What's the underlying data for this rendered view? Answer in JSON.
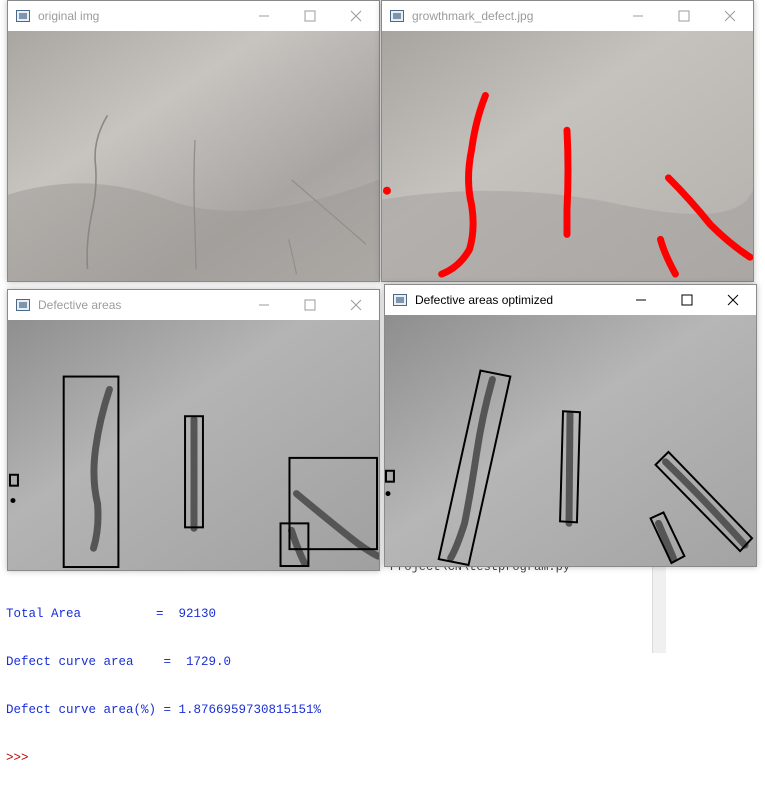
{
  "shell": {
    "total_area_line": "Total Area          =  92130",
    "defect_curve_line": "Defect curve area    =  1729.0",
    "defect_percent_line": "Defect curve area(%) = 1.8766959730815151%",
    "prompt": ">>>"
  },
  "windows": {
    "original": {
      "title": "original img"
    },
    "growthmark": {
      "title": "growthmark_defect.jpg"
    },
    "defective": {
      "title": "Defective areas"
    },
    "optimized": {
      "title": "Defective areas optimized"
    }
  },
  "icons": {
    "minimize": "minimize-icon",
    "maximize": "maximize-icon",
    "close": "close-icon",
    "app": "opencv-window-icon"
  },
  "colors": {
    "defect_marker": "#ff0000",
    "box_outline": "#000000",
    "shell_text": "#1a2fd6",
    "shell_prompt": "#c00000"
  }
}
